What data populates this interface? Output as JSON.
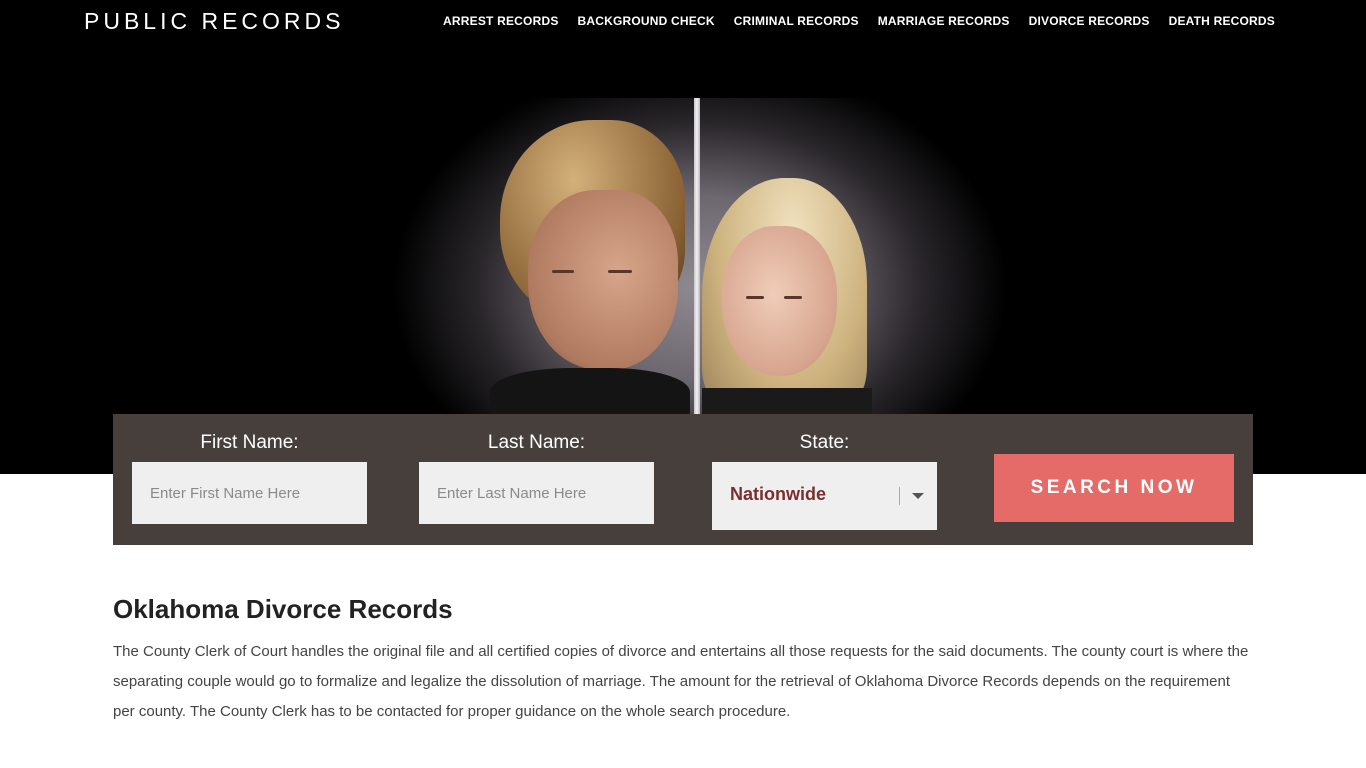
{
  "header": {
    "logo": "PUBLIC RECORDS",
    "nav": [
      {
        "label": "ARREST RECORDS"
      },
      {
        "label": "BACKGROUND CHECK"
      },
      {
        "label": "CRIMINAL RECORDS"
      },
      {
        "label": "MARRIAGE RECORDS"
      },
      {
        "label": "DIVORCE RECORDS"
      },
      {
        "label": "DEATH RECORDS"
      }
    ]
  },
  "search": {
    "first_name_label": "First Name:",
    "first_name_placeholder": "Enter First Name Here",
    "last_name_label": "Last Name:",
    "last_name_placeholder": "Enter Last Name Here",
    "state_label": "State:",
    "state_value": "Nationwide",
    "button_label": "SEARCH NOW"
  },
  "article": {
    "title": "Oklahoma Divorce Records",
    "paragraph": "The County Clerk of Court handles the original file and all certified copies of divorce and entertains all those requests for the said documents. The county court is where the separating couple would go to formalize and legalize the dissolution of marriage. The amount for the retrieval of Oklahoma Divorce Records depends on the requirement per county. The County Clerk has to be contacted for proper guidance on the whole search procedure."
  },
  "colors": {
    "panel": "#473f3c",
    "button": "#e46b67",
    "state_text": "#7a2f2f"
  }
}
